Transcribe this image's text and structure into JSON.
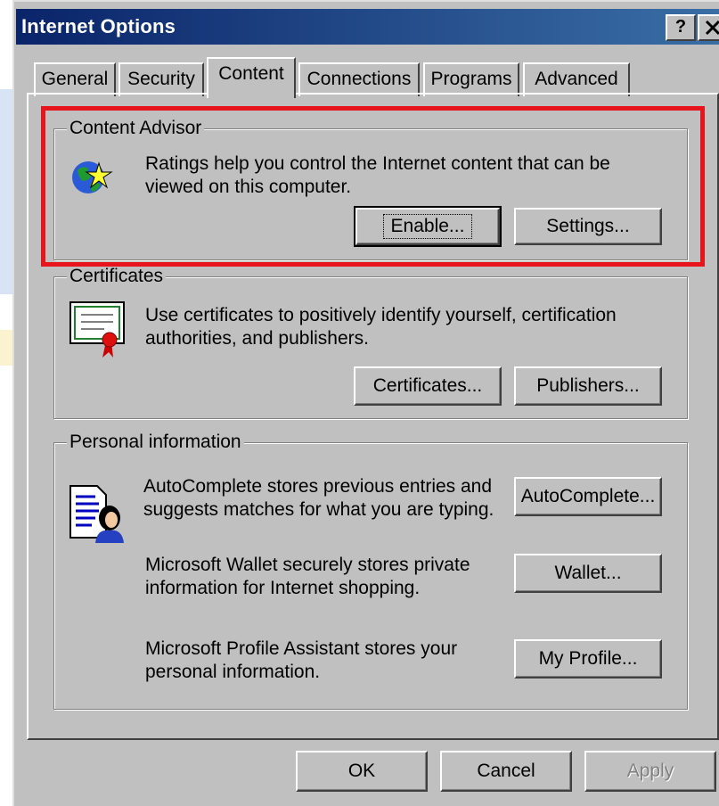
{
  "window": {
    "title": "Internet Options",
    "help_button": "?",
    "close_button": "X"
  },
  "tabs": [
    {
      "label": "General"
    },
    {
      "label": "Security"
    },
    {
      "label": "Content",
      "active": true
    },
    {
      "label": "Connections"
    },
    {
      "label": "Programs"
    },
    {
      "label": "Advanced"
    }
  ],
  "content_advisor": {
    "legend": "Content Advisor",
    "description_line1": "Ratings help you control the Internet content that can be",
    "description_line2": "viewed on this computer.",
    "enable_button": "Enable...",
    "settings_button": "Settings..."
  },
  "certificates": {
    "legend": "Certificates",
    "description_line1": "Use certificates to positively identify yourself, certification",
    "description_line2": "authorities, and publishers.",
    "certificates_button": "Certificates...",
    "publishers_button": "Publishers..."
  },
  "personal_information": {
    "legend": "Personal information",
    "autocomplete_line1": "AutoComplete stores previous entries and",
    "autocomplete_line2": "suggests matches for what you are typing.",
    "autocomplete_button": "AutoComplete...",
    "wallet_line1": "Microsoft Wallet securely stores private",
    "wallet_line2": "information for Internet shopping.",
    "wallet_button": "Wallet...",
    "profile_line1": "Microsoft Profile Assistant stores your",
    "profile_line2": "personal information.",
    "profile_button": "My Profile..."
  },
  "footer": {
    "ok_button": "OK",
    "cancel_button": "Cancel",
    "apply_button": "Apply"
  },
  "colors": {
    "highlight": "#e8141b",
    "titlebar": "#0a246a",
    "face": "#c0c0c0"
  }
}
